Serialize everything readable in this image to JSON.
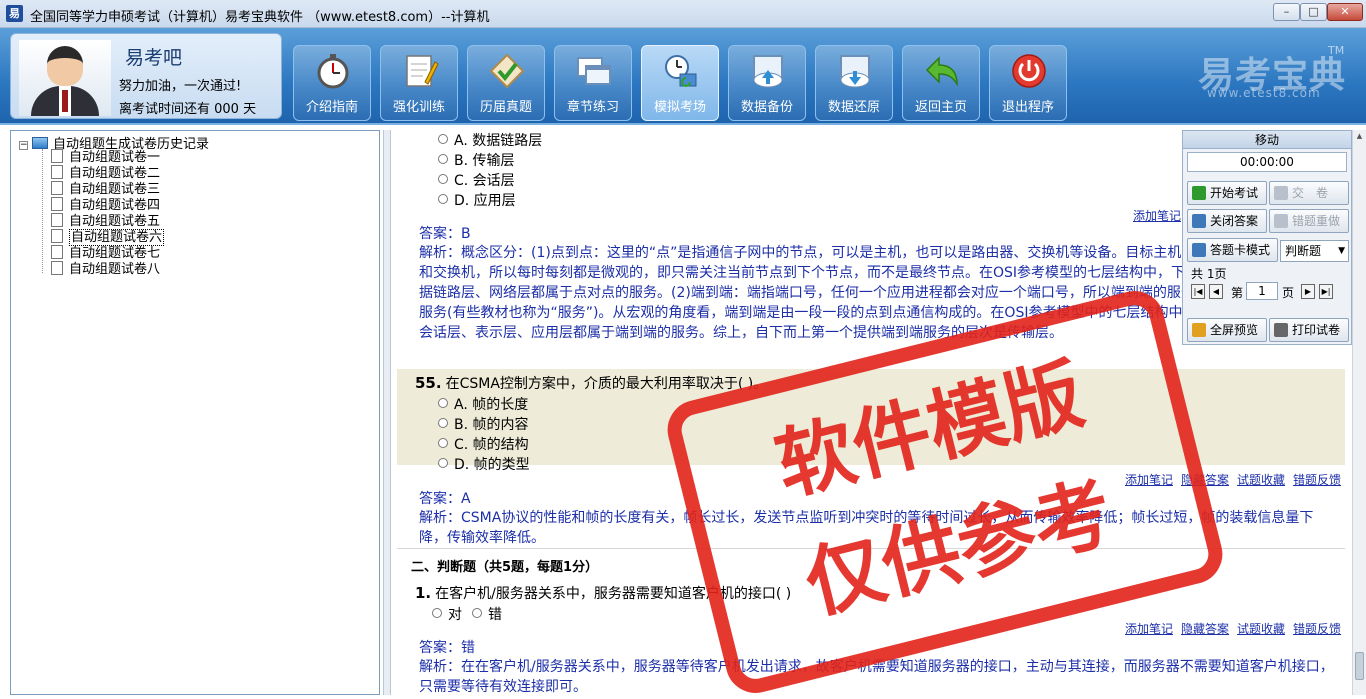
{
  "window": {
    "title": "全国同等学力申硕考试（计算机）易考宝典软件 （www.etest8.com）--计算机",
    "app_icon": "易",
    "minimize": "–",
    "maximize": "□",
    "close": "✕"
  },
  "profile": {
    "name": "易考吧",
    "motto": "努力加油，一次通过!",
    "countdown": "离考试时间还有 000 天"
  },
  "nav": [
    {
      "label": "介绍指南",
      "icon": "stopwatch-icon"
    },
    {
      "label": "强化训练",
      "icon": "notepad-icon"
    },
    {
      "label": "历届真题",
      "icon": "checkmark-box-icon"
    },
    {
      "label": "章节练习",
      "icon": "windows-icon"
    },
    {
      "label": "模拟考场",
      "icon": "exam-clock-icon"
    },
    {
      "label": "数据备份",
      "icon": "cloud-upload-icon"
    },
    {
      "label": "数据还原",
      "icon": "cloud-download-icon"
    },
    {
      "label": "返回主页",
      "icon": "back-arrow-icon"
    },
    {
      "label": "退出程序",
      "icon": "power-icon"
    }
  ],
  "brand": {
    "name": "易考宝典",
    "tm": "TM",
    "url": "www.etest8.com"
  },
  "tree": {
    "root": "自动组题生成试卷历史记录",
    "items": [
      "自动组题试卷一",
      "自动组题试卷二",
      "自动组题试卷三",
      "自动组题试卷四",
      "自动组题试卷五",
      "自动组题试卷六",
      "自动组题试卷七",
      "自动组题试卷八"
    ],
    "selected_index": 5
  },
  "q54": {
    "options": [
      "A. 数据链路层",
      "B. 传输层",
      "C. 会话层",
      "D. 应用层"
    ],
    "answer": "答案：B",
    "explanation": "解析：概念区分：(1)点到点：这里的“点”是指通信子网中的节点，可以是主机，也可以是路由器、交换机等设备。目标主机中间可能经过多个路由器和交换机，所以每时每刻都是微观的，即只需关注当前节点到下个节点，而不是最终节点。在OSI参考模型的七层结构中，下面三层包括物理层、数据链路层、网络层都属于点对点的服务。(2)端到端：端指端口号，任何一个应用进程都会对应一个端口号，所以端到端的服务又被称为进程到进程的服务(有些教材也称为“服务”)。从宏观的角度看，端到端是由一段一段的点到点通信构成的。在OSI参考模型中的七层结构中，上面四层，即传输层、会话层、表示层、应用层都属于端到端的服务。综上，自下而上第一个提供端到端服务的层次是传输层。",
    "add_note": "添加笔记"
  },
  "q55": {
    "number": "55.",
    "text": "在CSMA控制方案中，介质的最大利用率取决于(  )。",
    "options": [
      "A. 帧的长度",
      "B. 帧的内容",
      "C. 帧的结构",
      "D. 帧的类型"
    ],
    "answer": "答案：A",
    "explanation": "解析：CSMA协议的性能和帧的长度有关，帧长过长，发送节点监听到冲突时的等待时间过长，从而传输效率降低；帧长过短，帧的装载信息量下降，传输效率降低。",
    "links": [
      "添加笔记",
      "隐藏答案",
      "试题收藏",
      "错题反馈"
    ]
  },
  "section": {
    "title": "二、判断题（共5题，每题1分）"
  },
  "j1": {
    "number": "1.",
    "text": "在客户机/服务器关系中，服务器需要知道客户机的接口(  )",
    "options": [
      "对",
      "错"
    ],
    "answer": "答案：错",
    "explanation": "解析：在在客户机/服务器关系中，服务器等待客户机发出请求，故客户机需要知道服务器的接口，主动与其连接，而服务器不需要知道客户机接口，只需要等待有效连接即可。",
    "links": [
      "添加笔记",
      "隐藏答案",
      "试题收藏",
      "错题反馈"
    ]
  },
  "watermark": {
    "line1": "软件模版",
    "line2": "仅供参考",
    "color": "#e2231a"
  },
  "panel": {
    "title": "移动",
    "timer": "00:00:00",
    "start_exam": "开始考试",
    "submit": "交　卷",
    "close_answer": "关闭答案",
    "wrong_redo": "错题重做",
    "card_mode": "答题卡模式",
    "type_select": "判断题",
    "total_pages": "共 1页",
    "page_prefix": "第",
    "page_value": "1",
    "page_suffix": "页",
    "fullscreen": "全屏预览",
    "print": "打印试卷"
  }
}
